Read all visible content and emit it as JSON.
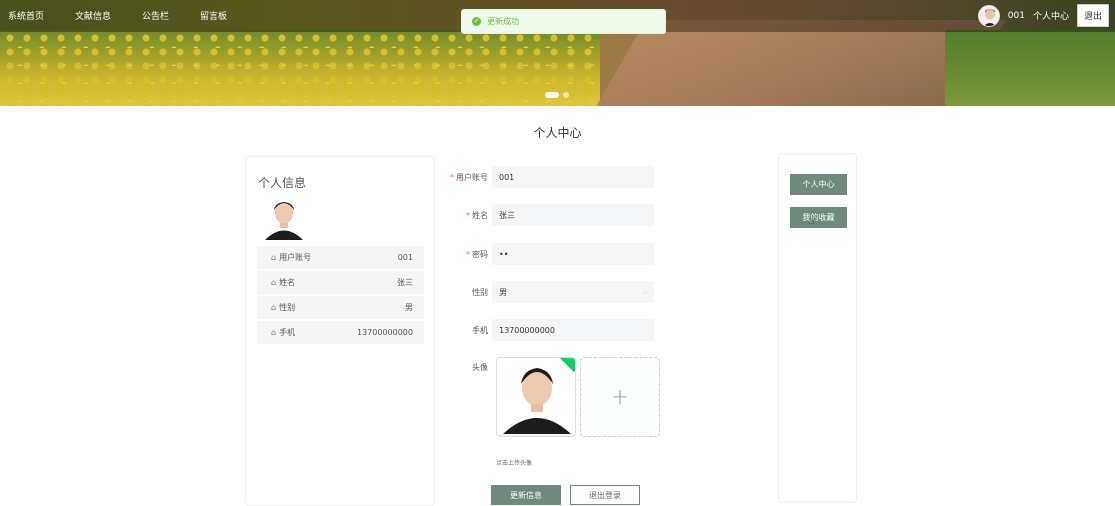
{
  "nav": {
    "items": [
      "系统首页",
      "文献信息",
      "公告栏",
      "留言板"
    ]
  },
  "user": {
    "account": "001",
    "center_link": "个人中心",
    "logout": "退出"
  },
  "toast": {
    "message": "更新成功",
    "type": "success"
  },
  "page_title": "个人中心",
  "profile_card": {
    "title": "个人信息",
    "fields": [
      {
        "label": "用户账号",
        "value": "001"
      },
      {
        "label": "姓名",
        "value": "张三"
      },
      {
        "label": "性别",
        "value": "男"
      },
      {
        "label": "手机",
        "value": "13700000000"
      }
    ]
  },
  "form": {
    "account": {
      "label": "用户账号",
      "value": "001",
      "required": true
    },
    "name": {
      "label": "姓名",
      "value": "张三",
      "required": true
    },
    "password": {
      "label": "密码",
      "value": "••",
      "required": true
    },
    "gender": {
      "label": "性别",
      "value": "男",
      "required": false
    },
    "phone": {
      "label": "手机",
      "value": "13700000000",
      "required": false
    },
    "avatar": {
      "label": "头像",
      "hint": "点击上传头像"
    },
    "update_button": "更新信息",
    "logout_button": "退出登录"
  },
  "side_menu": {
    "items": [
      "个人中心",
      "我的收藏"
    ]
  },
  "colors": {
    "accent": "#6f8a7d",
    "success": "#67c23a",
    "required": "#f56c6c"
  }
}
